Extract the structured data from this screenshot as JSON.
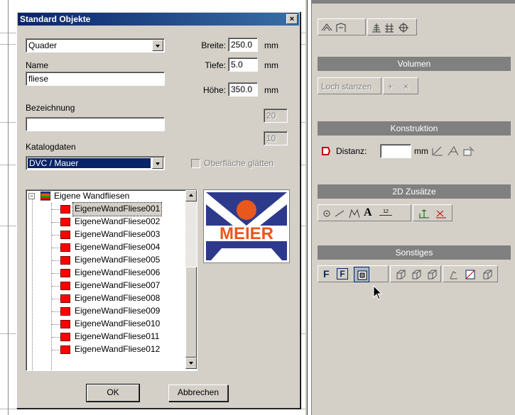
{
  "dialog": {
    "title": "Standard Objekte",
    "close_label": "×",
    "shape_combo": {
      "value": "Quader"
    },
    "name_label": "Name",
    "name_value": "fliese",
    "bezeichnung_label": "Bezeichnung",
    "bezeichnung_value": "",
    "katalog_label": "Katalogdaten",
    "katalog_combo": {
      "value": "DVC / Mauer"
    },
    "breite": {
      "label": "Breite:",
      "value": "250.0",
      "unit": "mm"
    },
    "tiefe": {
      "label": "Tiefe:",
      "value": "5.0",
      "unit": "mm"
    },
    "hoehe": {
      "label": "Höhe:",
      "value": "350.0",
      "unit": "mm"
    },
    "spin1_value": "20",
    "spin2_value": "10",
    "oberflaeche_label": "Oberfläche glätten",
    "tree": {
      "root": "Eigene Wandfliesen",
      "items": [
        "EigeneWandFliese001",
        "EigeneWandFliese002",
        "EigeneWandFliese003",
        "EigeneWandFliese004",
        "EigeneWandFliese005",
        "EigeneWandFliese006",
        "EigeneWandFliese007",
        "EigeneWandFliese008",
        "EigeneWandFliese009",
        "EigeneWandFliese010",
        "EigeneWandFliese011",
        "EigeneWandFliese012"
      ],
      "selected_index": 0
    },
    "logo_text": "MEIER",
    "ok_label": "OK",
    "cancel_label": "Abbrechen"
  },
  "panel": {
    "volumen": {
      "header": "Volumen",
      "loch_label": "Loch stanzen",
      "plus": "+",
      "times": "×"
    },
    "konstruktion": {
      "header": "Konstruktion",
      "distanz_label": "Distanz:",
      "distanz_value": "",
      "unit": "mm"
    },
    "zusaetze": {
      "header": "2D Zusätze",
      "text_glyph": "A",
      "dim_label": "12"
    },
    "sonstiges": {
      "header": "Sonstiges",
      "f_glyph": "F"
    }
  },
  "colors": {
    "title_start": "#0a246a",
    "title_end": "#3a6ea5",
    "selection": "#0a246a",
    "tile_red": "#ff0000",
    "logo_blue": "#2d3a8c",
    "logo_orange": "#e8581c",
    "face": "#d4d0c8"
  }
}
